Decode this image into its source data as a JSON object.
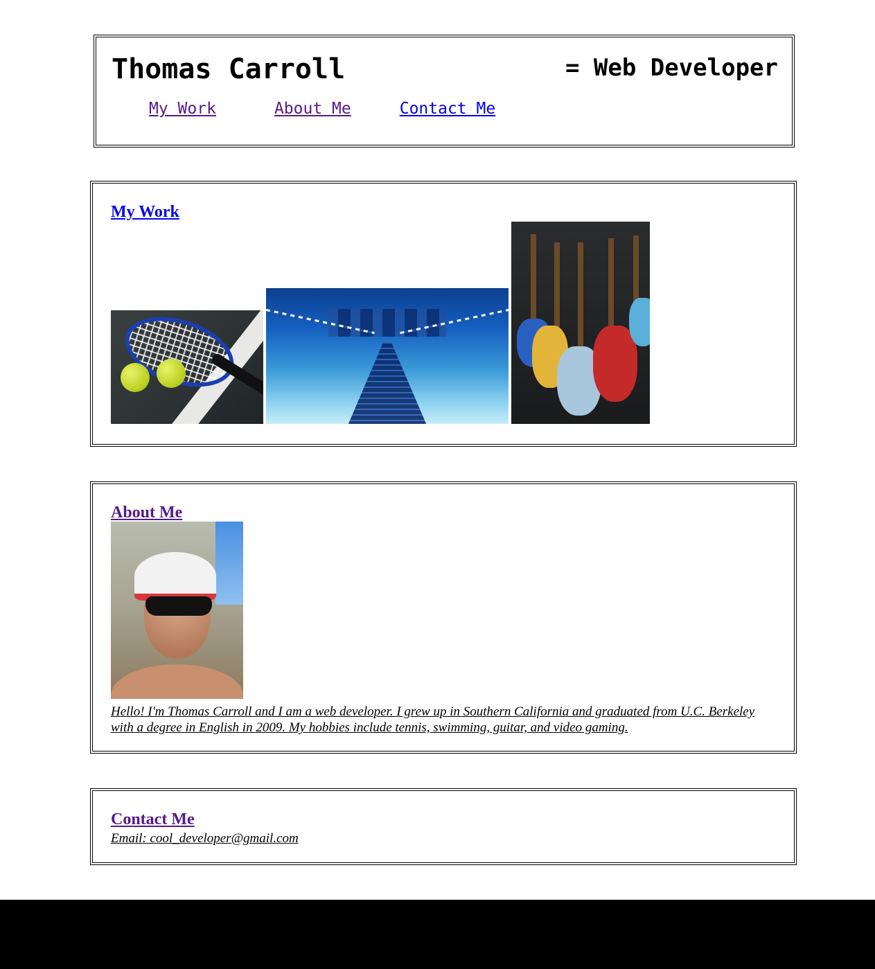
{
  "header": {
    "name": "Thomas Carroll",
    "role": "= Web Developer",
    "nav": [
      {
        "label": "My Work"
      },
      {
        "label": "About Me"
      },
      {
        "label": "Contact Me"
      }
    ]
  },
  "work": {
    "title": "My Work",
    "images": [
      {
        "icon": "tennis-image"
      },
      {
        "icon": "swimming-pool-image"
      },
      {
        "icon": "guitars-image"
      }
    ]
  },
  "about": {
    "title": "About Me",
    "photo": "portrait-photo",
    "text": "Hello! I'm Thomas Carroll and I am a web developer. I grew up in Southern California and graduated from U.C. Berkeley with a degree in English in 2009. My hobbies include tennis, swimming, guitar, and video gaming."
  },
  "contact": {
    "title": "Contact Me",
    "email": "Email: cool_developer@gmail.com"
  },
  "colors": {
    "link_visited": "#551a8b",
    "link_unvisited": "#0000ee",
    "footer": "#000000"
  }
}
